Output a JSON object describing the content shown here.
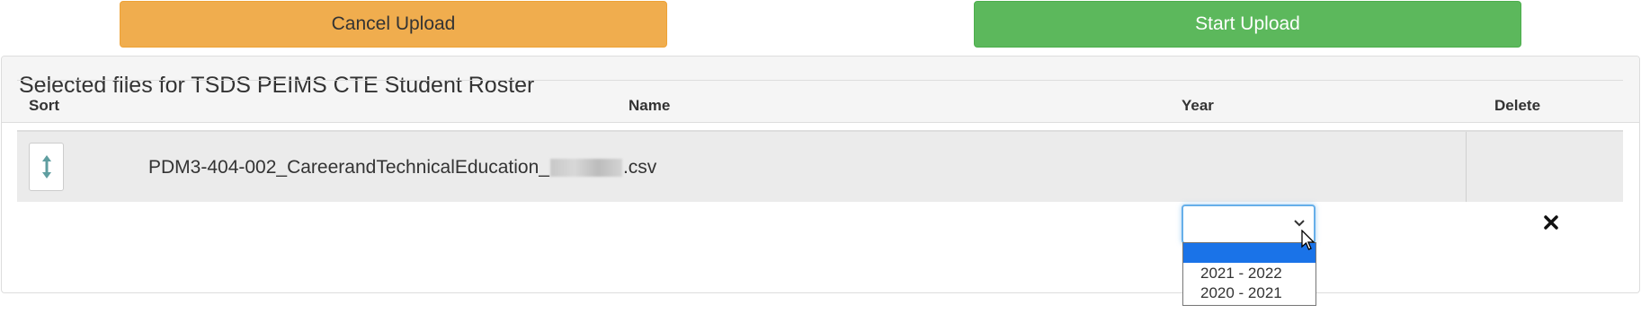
{
  "buttons": {
    "cancel_label": "Cancel Upload",
    "start_label": "Start Upload"
  },
  "panel": {
    "title": "Selected files for TSDS PEIMS CTE Student Roster"
  },
  "table": {
    "headers": {
      "sort": "Sort",
      "name": "Name",
      "year": "Year",
      "delete": "Delete"
    },
    "rows": [
      {
        "name_prefix": "PDM3-404-002_CareerandTechnicalEducation_",
        "name_suffix": ".csv",
        "year_selected": ""
      }
    ]
  },
  "year_dropdown": {
    "options": [
      "",
      "2021 - 2022",
      "2020 - 2021"
    ],
    "highlighted_index": 0
  },
  "icons": {
    "sort": "sort-vertical-icon",
    "delete": "close-icon",
    "chevron": "chevron-down-icon",
    "cursor": "mouse-pointer-icon"
  },
  "colors": {
    "cancel_bg": "#f0ad4e",
    "start_bg": "#5cb85c",
    "focus_border": "#66afe9",
    "option_highlight": "#1a73e8",
    "sort_icon": "#5f9ea0"
  }
}
